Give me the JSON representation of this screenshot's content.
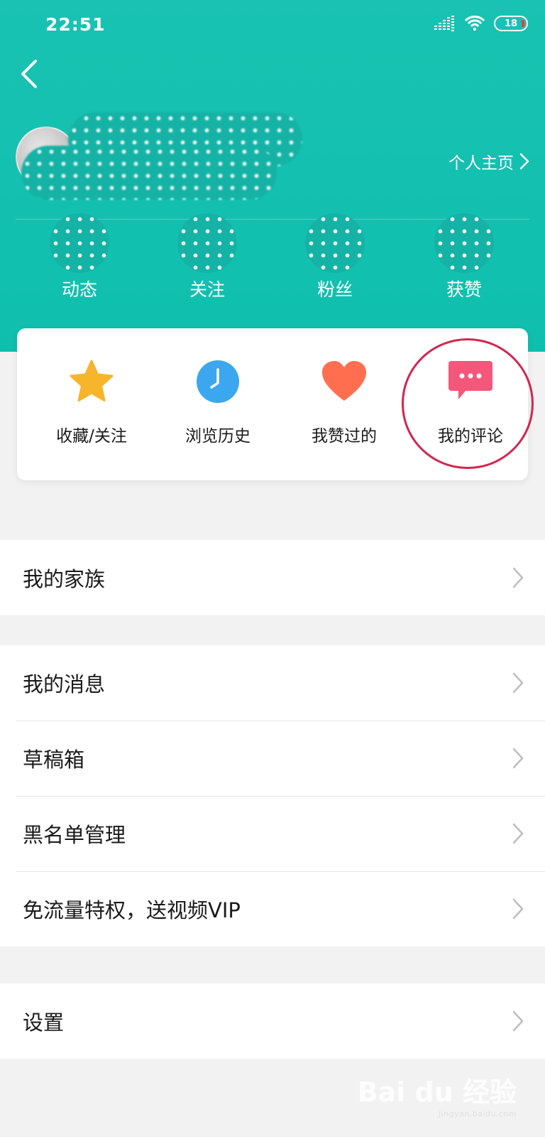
{
  "status_bar": {
    "time": "22:51",
    "battery": "18"
  },
  "header": {
    "homepage_link": "个人主页"
  },
  "stats": [
    {
      "label": "动态"
    },
    {
      "label": "关注"
    },
    {
      "label": "粉丝"
    },
    {
      "label": "获赞"
    }
  ],
  "quick_actions": [
    {
      "label": "收藏/关注",
      "icon": "star-icon",
      "color": "#f7b52c"
    },
    {
      "label": "浏览历史",
      "icon": "clock-icon",
      "color": "#3aa7ef"
    },
    {
      "label": "我赞过的",
      "icon": "heart-icon",
      "color": "#ff6f4f"
    },
    {
      "label": "我的评论",
      "icon": "comment-icon",
      "color": "#f5577a"
    }
  ],
  "menu_group1": [
    {
      "label": "我的家族"
    }
  ],
  "menu_group2": [
    {
      "label": "我的消息"
    },
    {
      "label": "草稿箱"
    },
    {
      "label": "黑名单管理"
    },
    {
      "label": "免流量特权，送视频VIP"
    }
  ],
  "menu_group3": [
    {
      "label": "设置"
    }
  ],
  "watermark": {
    "text": "Bai du 经验",
    "sub": "jingyan.baidu.com"
  },
  "colors": {
    "header": "#19c2b2",
    "highlight_ring": "#d3264e"
  }
}
